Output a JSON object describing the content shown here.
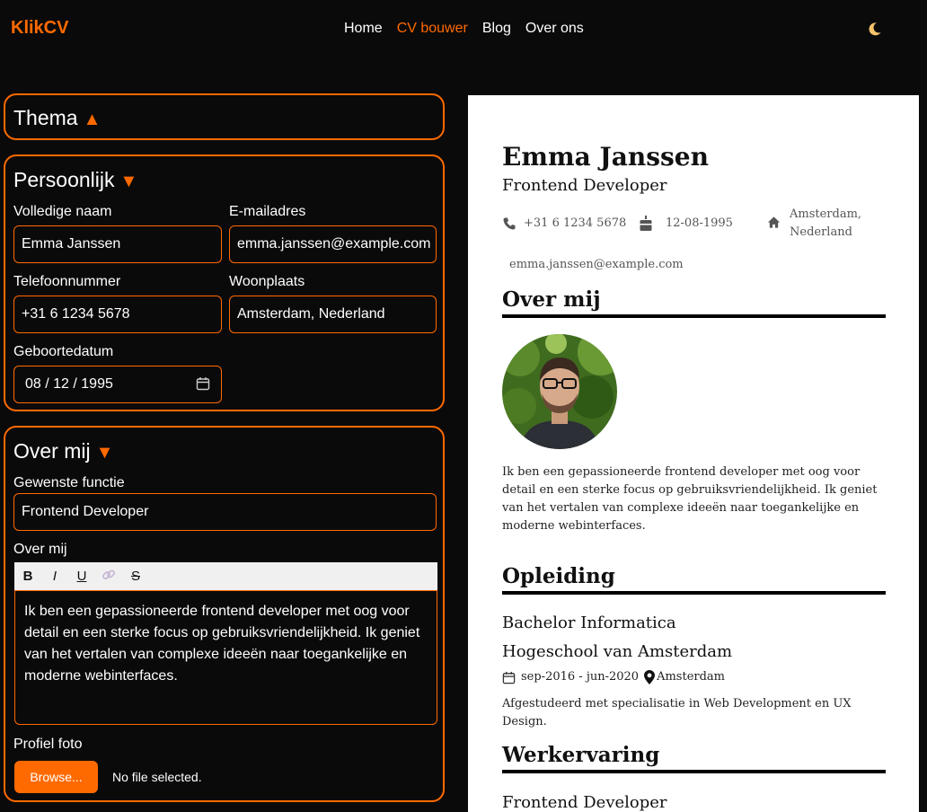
{
  "header": {
    "logo": "KlikCV",
    "nav": [
      "Home",
      "CV bouwer",
      "Blog",
      "Over ons"
    ],
    "active_index": 1,
    "theme_icon": "moon-icon"
  },
  "editor": {
    "theme_panel": {
      "title": "Thema",
      "toggle": "▲"
    },
    "personal_panel": {
      "title": "Persoonlijk",
      "toggle": "▼",
      "full_name_label": "Volledige naam",
      "full_name": "Emma Janssen",
      "email_label": "E-mailadres",
      "email": "emma.janssen@example.com",
      "phone_label": "Telefoonnummer",
      "phone": "+31 6 1234 5678",
      "city_label": "Woonplaats",
      "city": "Amsterdam, Nederland",
      "birth_label": "Geboortedatum",
      "birth": "08 / 12 / 1995"
    },
    "about_panel": {
      "title": "Over mij",
      "toggle": "▼",
      "job_label": "Gewenste functie",
      "job": "Frontend Developer",
      "about_label": "Over mij",
      "toolbar": [
        "B",
        "I",
        "U",
        "🔗",
        "S"
      ],
      "about_text": "Ik ben een gepassioneerde frontend developer met oog voor detail en een sterke focus op gebruiksvriendelijkheid. Ik geniet van het vertalen van complexe ideeën naar toegankelijke en moderne webinterfaces.",
      "photo_label": "Profiel foto",
      "browse": "Browse...",
      "no_file": "No file selected."
    }
  },
  "cv": {
    "name": "Emma Janssen",
    "role": "Frontend Developer",
    "phone": "+31 6 1234 5678",
    "birth": "12-08-1995",
    "city_line1": "Amsterdam,",
    "city_line2": "Nederland",
    "email": "emma.janssen@example.com",
    "about_heading": "Over mij",
    "about_text": "Ik ben een gepassioneerde frontend developer met oog voor detail en een sterke focus op gebruiksvriendelijkheid. Ik geniet van het vertalen van complexe ideeën naar toegankelijke en moderne webinterfaces.",
    "education_heading": "Opleiding",
    "degree": "Bachelor Informatica",
    "school": "Hogeschool van Amsterdam",
    "edu_period": "sep-2016 - jun-2020",
    "edu_city": "Amsterdam",
    "edu_desc": "Afgestudeerd met specialisatie in Web Development en UX Design.",
    "work_heading": "Werkervaring",
    "work_title": "Frontend Developer"
  },
  "colors": {
    "accent": "#ff6a00",
    "background": "#0b0a0a"
  }
}
